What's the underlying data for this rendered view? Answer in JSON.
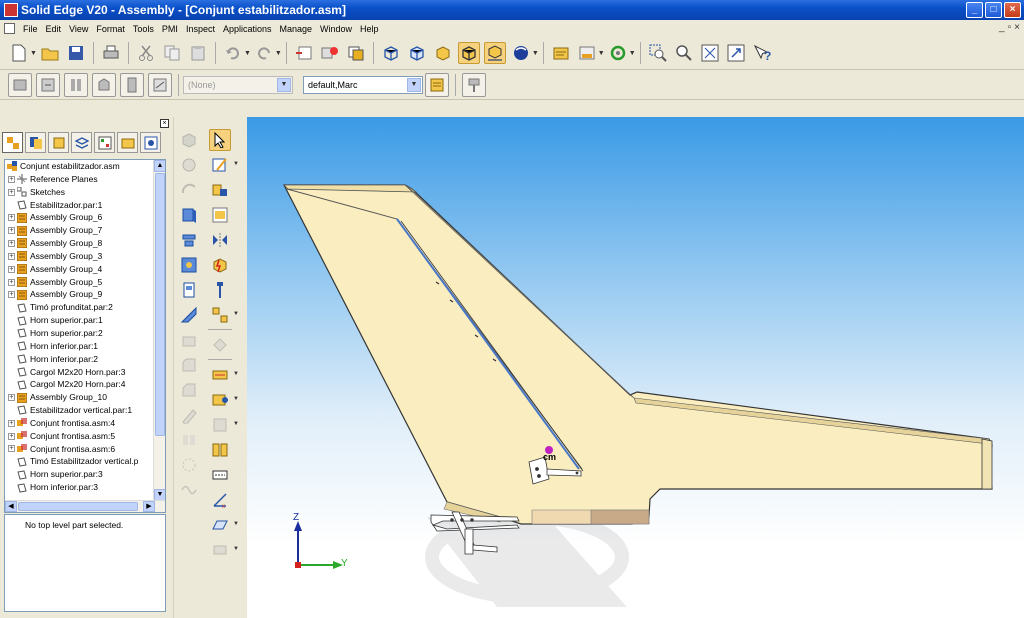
{
  "window": {
    "title": "Solid Edge V20 - Assembly - [Conjunt estabilitzador.asm]",
    "controls": [
      "_",
      "□",
      "×"
    ]
  },
  "menu": {
    "items": [
      "File",
      "Edit",
      "View",
      "Format",
      "Tools",
      "PMI",
      "Inspect",
      "Applications",
      "Manage",
      "Window",
      "Help"
    ],
    "mdi_controls": [
      "_",
      "▫",
      "×"
    ]
  },
  "toolbar2": {
    "layer_combo_value": "(None)",
    "style_combo_value": "default,Marc"
  },
  "pathfinder": {
    "close_label": "×",
    "tree": [
      {
        "label": "Conjunt estabilitzador.asm",
        "expander": "",
        "icon": "assembly-root-icon",
        "level": 0
      },
      {
        "label": "Reference Planes",
        "expander": "+",
        "icon": "reference-planes-icon",
        "level": 1
      },
      {
        "label": "Sketches",
        "expander": "+",
        "icon": "sketches-icon",
        "level": 1
      },
      {
        "label": "Estabilitzador.par:1",
        "expander": "",
        "icon": "part-icon",
        "level": 1
      },
      {
        "label": "Assembly Group_6",
        "expander": "+",
        "icon": "assembly-group-icon",
        "level": 1
      },
      {
        "label": "Assembly Group_7",
        "expander": "+",
        "icon": "assembly-group-icon",
        "level": 1
      },
      {
        "label": "Assembly Group_8",
        "expander": "+",
        "icon": "assembly-group-icon",
        "level": 1
      },
      {
        "label": "Assembly Group_3",
        "expander": "+",
        "icon": "assembly-group-icon",
        "level": 1
      },
      {
        "label": "Assembly Group_4",
        "expander": "+",
        "icon": "assembly-group-icon",
        "level": 1
      },
      {
        "label": "Assembly Group_5",
        "expander": "+",
        "icon": "assembly-group-icon",
        "level": 1
      },
      {
        "label": "Assembly Group_9",
        "expander": "+",
        "icon": "assembly-group-icon",
        "level": 1
      },
      {
        "label": "Timó profunditat.par:2",
        "expander": "",
        "icon": "part-icon",
        "level": 1
      },
      {
        "label": "Horn superior.par:1",
        "expander": "",
        "icon": "part-icon",
        "level": 1
      },
      {
        "label": "Horn superior.par:2",
        "expander": "",
        "icon": "part-icon",
        "level": 1
      },
      {
        "label": "Horn inferior.par:1",
        "expander": "",
        "icon": "part-icon",
        "level": 1
      },
      {
        "label": "Horn inferior.par:2",
        "expander": "",
        "icon": "part-icon",
        "level": 1
      },
      {
        "label": "Cargol M2x20 Horn.par:3",
        "expander": "",
        "icon": "part-icon",
        "level": 1
      },
      {
        "label": "Cargol M2x20 Horn.par:4",
        "expander": "",
        "icon": "part-icon",
        "level": 1
      },
      {
        "label": "Assembly Group_10",
        "expander": "+",
        "icon": "assembly-group-icon",
        "level": 1
      },
      {
        "label": "Estabilitzador vertical.par:1",
        "expander": "",
        "icon": "part-icon",
        "level": 1
      },
      {
        "label": "Conjunt frontisa.asm:4",
        "expander": "+",
        "icon": "subassembly-icon",
        "level": 1
      },
      {
        "label": "Conjunt frontisa.asm:5",
        "expander": "+",
        "icon": "subassembly-icon",
        "level": 1
      },
      {
        "label": "Conjunt frontisa.asm:6",
        "expander": "+",
        "icon": "subassembly-icon",
        "level": 1
      },
      {
        "label": "Timó Estabilitzador vertical.p",
        "expander": "",
        "icon": "part-icon",
        "level": 1
      },
      {
        "label": "Horn superior.par:3",
        "expander": "",
        "icon": "part-icon",
        "level": 1
      },
      {
        "label": "Horn inferior.par:3",
        "expander": "",
        "icon": "part-icon",
        "level": 1
      }
    ],
    "status_message": "No top level part selected."
  },
  "viewport": {
    "center_of_mass_label": "cm",
    "axis_z_label": "Z",
    "axis_y_label": "Y"
  },
  "colors": {
    "part_fill": "#faeec0",
    "part_edge": "#333333",
    "viewport_top": "#3a9ae6",
    "axis_z": "#1a2ea0",
    "axis_y": "#2ba82b",
    "axis_x": "#d62020",
    "cm_marker": "#c020c0"
  }
}
